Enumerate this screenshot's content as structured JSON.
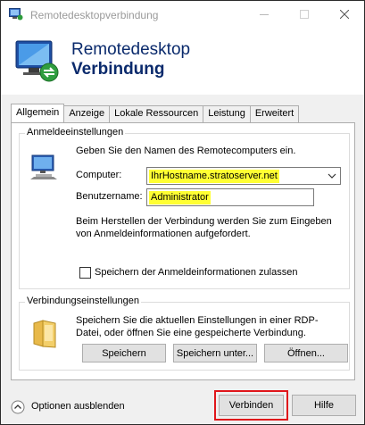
{
  "window": {
    "title": "Remotedesktopverbindung",
    "controls": {
      "minimize": "minimize",
      "maximize": "maximize",
      "close": "close"
    }
  },
  "banner": {
    "line1": "Remotedesktop",
    "line2": "Verbindung"
  },
  "tabs": [
    {
      "label": "Allgemein",
      "active": true
    },
    {
      "label": "Anzeige"
    },
    {
      "label": "Lokale Ressourcen"
    },
    {
      "label": "Leistung"
    },
    {
      "label": "Erweitert"
    }
  ],
  "login_group": {
    "title": "Anmeldeeinstellungen",
    "intro": "Geben Sie den Namen des Remotecomputers ein.",
    "computer_label": "Computer:",
    "computer_value": "IhrHostname.stratoserver.net",
    "username_label": "Benutzername:",
    "username_value": "Administrator",
    "info_text": "Beim Herstellen der Verbindung werden Sie zum Eingeben von Anmeldeinformationen aufgefordert.",
    "save_credentials_label": "Speichern der Anmeldeinformationen zulassen",
    "save_credentials_checked": false
  },
  "connection_group": {
    "title": "Verbindungseinstellungen",
    "description": "Speichern Sie die aktuellen Einstellungen in einer RDP-Datei, oder öffnen Sie eine gespeicherte Verbindung.",
    "save_button": "Speichern",
    "save_as_button": "Speichern unter...",
    "open_button": "Öffnen..."
  },
  "footer": {
    "options_label": "Optionen ausblenden",
    "connect_button": "Verbinden",
    "help_button": "Hilfe"
  },
  "colors": {
    "highlight_text_bg": "#ffff33",
    "connect_highlight_border": "#e0161b",
    "banner_text": "#0a2a6c"
  }
}
